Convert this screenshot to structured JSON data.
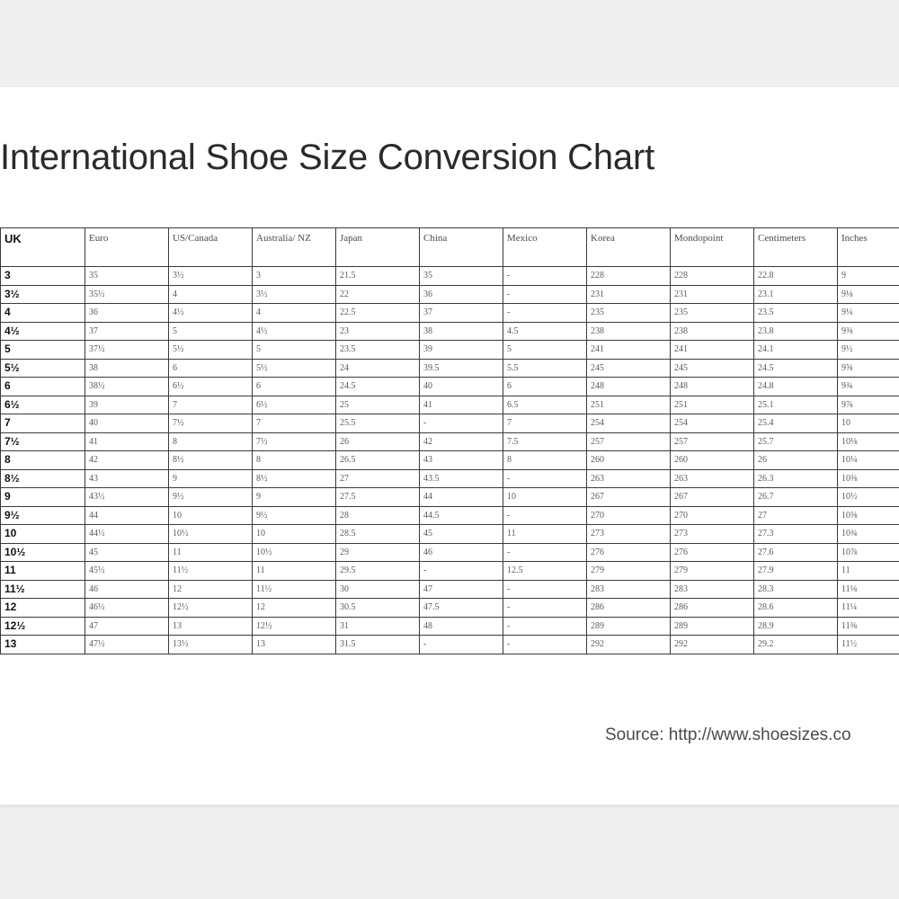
{
  "document": {
    "title": "International Shoe Size Conversion Chart",
    "source": "Source: http://www.shoesizes.co"
  },
  "table": {
    "headers": [
      "UK",
      "Euro",
      "US/Canada",
      "Australia/ NZ",
      "Japan",
      "China",
      "Mexico",
      "Korea",
      "Mondopoint",
      "Centimeters",
      "Inches"
    ],
    "rows": [
      [
        "3",
        "35",
        "3½",
        "3",
        "21.5",
        "35",
        "-",
        "228",
        "228",
        "22.8",
        "9"
      ],
      [
        "3½",
        "35½",
        "4",
        "3½",
        "22",
        "36",
        "-",
        "231",
        "231",
        "23.1",
        "9⅛"
      ],
      [
        "4",
        "36",
        "4½",
        "4",
        "22.5",
        "37",
        "-",
        "235",
        "235",
        "23.5",
        "9¼"
      ],
      [
        "4½",
        "37",
        "5",
        "4½",
        "23",
        "38",
        "4.5",
        "238",
        "238",
        "23.8",
        "9⅜"
      ],
      [
        "5",
        "37½",
        "5½",
        "5",
        "23.5",
        "39",
        "5",
        "241",
        "241",
        "24.1",
        "9½"
      ],
      [
        "5½",
        "38",
        "6",
        "5½",
        "24",
        "39.5",
        "5.5",
        "245",
        "245",
        "24.5",
        "9⅝"
      ],
      [
        "6",
        "38½",
        "6½",
        "6",
        "24.5",
        "40",
        "6",
        "248",
        "248",
        "24.8",
        "9¾"
      ],
      [
        "6½",
        "39",
        "7",
        "6½",
        "25",
        "41",
        "6.5",
        "251",
        "251",
        "25.1",
        "9⅞"
      ],
      [
        "7",
        "40",
        "7½",
        "7",
        "25.5",
        "-",
        "7",
        "254",
        "254",
        "25.4",
        "10"
      ],
      [
        "7½",
        "41",
        "8",
        "7½",
        "26",
        "42",
        "7.5",
        "257",
        "257",
        "25.7",
        "10⅛"
      ],
      [
        "8",
        "42",
        "8½",
        "8",
        "26.5",
        "43",
        "8",
        "260",
        "260",
        "26",
        "10¼"
      ],
      [
        "8½",
        "43",
        "9",
        "8½",
        "27",
        "43.5",
        "-",
        "263",
        "263",
        "26.3",
        "10⅜"
      ],
      [
        "9",
        "43½",
        "9½",
        "9",
        "27.5",
        "44",
        "10",
        "267",
        "267",
        "26.7",
        "10½"
      ],
      [
        "9½",
        "44",
        "10",
        "9½",
        "28",
        "44.5",
        "-",
        "270",
        "270",
        "27",
        "10⅝"
      ],
      [
        "10",
        "44½",
        "10½",
        "10",
        "28.5",
        "45",
        "11",
        "273",
        "273",
        "27.3",
        "10¾"
      ],
      [
        "10½",
        "45",
        "11",
        "10½",
        "29",
        "46",
        "-",
        "276",
        "276",
        "27.6",
        "10⅞"
      ],
      [
        "11",
        "45½",
        "11½",
        "11",
        "29.5",
        "-",
        "12.5",
        "279",
        "279",
        "27.9",
        "11"
      ],
      [
        "11½",
        "46",
        "12",
        "11½",
        "30",
        "47",
        "-",
        "283",
        "283",
        "28.3",
        "11⅛"
      ],
      [
        "12",
        "46½",
        "12½",
        "12",
        "30.5",
        "47.5",
        "-",
        "286",
        "286",
        "28.6",
        "11¼"
      ],
      [
        "12½",
        "47",
        "13",
        "12½",
        "31",
        "48",
        "-",
        "289",
        "289",
        "28.9",
        "11⅜"
      ],
      [
        "13",
        "47½",
        "13½",
        "13",
        "31.5",
        "-",
        "-",
        "292",
        "292",
        "29.2",
        "11½"
      ]
    ]
  }
}
